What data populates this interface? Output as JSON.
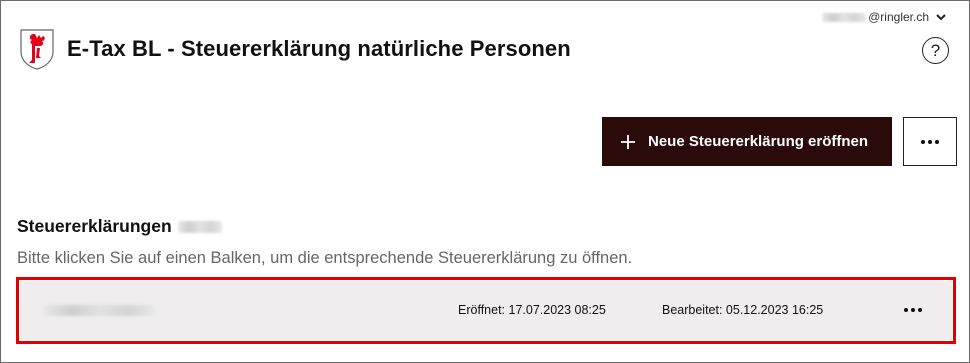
{
  "account": {
    "email_suffix": "@ringler.ch",
    "chevron_icon": "chevron-down-icon"
  },
  "header": {
    "logo_icon": "basel-landschaft-coat-of-arms-icon",
    "title": "E-Tax BL - Steuererklärung natürliche Personen",
    "help_glyph": "?"
  },
  "actions": {
    "new_return_label": "Neue Steuererklärung eröffnen",
    "more_icon": "more-horizontal-icon"
  },
  "section": {
    "title": "Steuererklärungen",
    "hint": "Bitte klicken Sie auf einen Balken, um die entsprechende Steuererklärung zu öffnen."
  },
  "returns": [
    {
      "opened": "Eröffnet: 17.07.2023 08:25",
      "edited": "Bearbeitet: 05.12.2023 16:25"
    }
  ],
  "colors": {
    "primary": "#2b0a0a",
    "highlight": "#e00000",
    "row_bg": "#efeded",
    "logo_red": "#e2001a"
  }
}
